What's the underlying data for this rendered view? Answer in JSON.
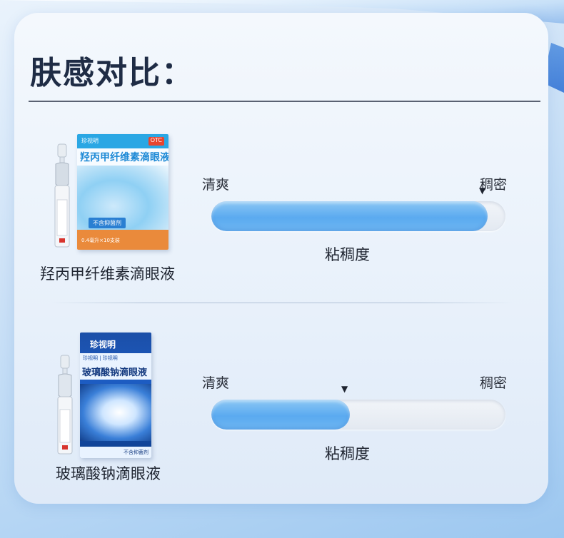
{
  "page": {
    "title": "肤感对比："
  },
  "colors": {
    "title": "#1f2c45",
    "bar_fill": "#5aaaf0",
    "track": "#e3e9f1"
  },
  "products": [
    {
      "name": "羟丙甲纤维素滴眼液",
      "box_brand": "珍视明",
      "box_title": "羟丙甲纤维素滴眼液",
      "box_tag": "不含抑菌剂",
      "box_note": "0.4毫升×10支装",
      "scale": {
        "left_label": "清爽",
        "right_label": "稠密",
        "axis_title": "粘稠度",
        "level": 0.94
      }
    },
    {
      "name": "玻璃酸钠滴眼液",
      "box_brand": "珍视明",
      "box_bar": "珍视明 | 珍视明",
      "box_title": "玻璃酸钠滴眼液",
      "box_foot": "不含抑菌剂",
      "scale": {
        "left_label": "清爽",
        "right_label": "稠密",
        "axis_title": "粘稠度",
        "level": 0.47
      }
    }
  ],
  "icons": {
    "marker": "triangle-down"
  }
}
